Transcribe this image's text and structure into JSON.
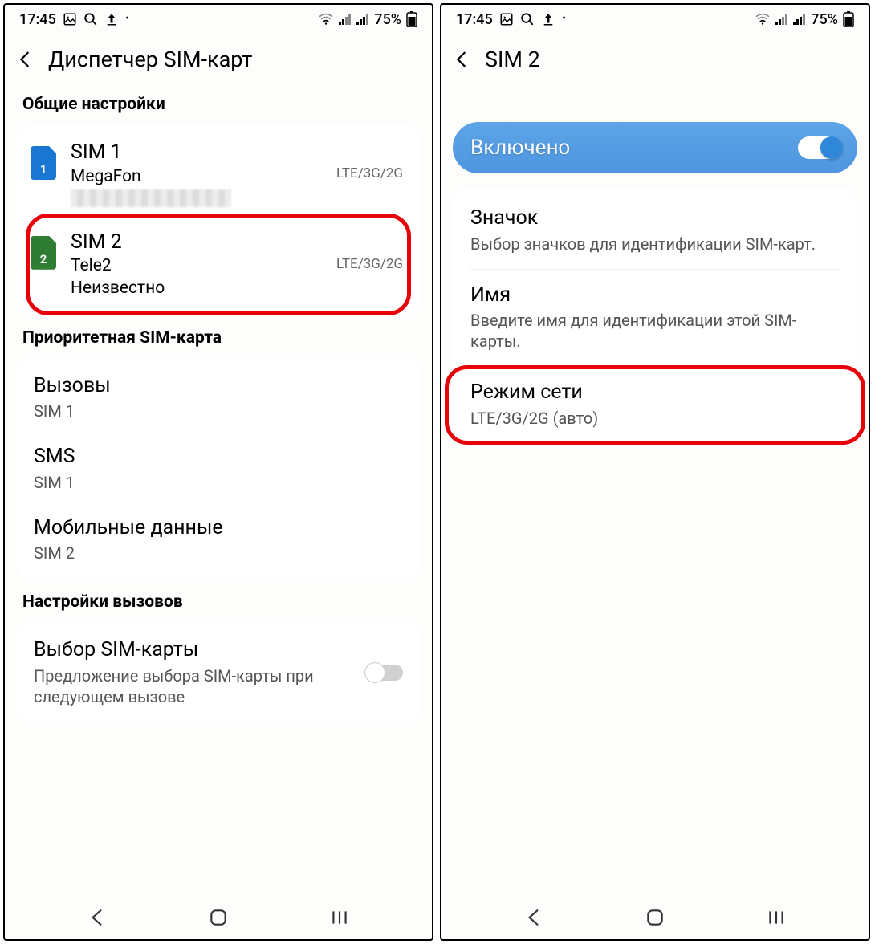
{
  "status": {
    "time": "17:45",
    "battery": "75%"
  },
  "left": {
    "title": "Диспетчер SIM-карт",
    "section_general": "Общие настройки",
    "sim1": {
      "name": "SIM 1",
      "carrier": "MegaFon",
      "mode": "LTE/3G/2G",
      "num": "1"
    },
    "sim2": {
      "name": "SIM 2",
      "carrier": "Tele2",
      "status": "Неизвестно",
      "mode": "LTE/3G/2G",
      "num": "2"
    },
    "section_priority": "Приоритетная SIM-карта",
    "calls": {
      "title": "Вызовы",
      "sub": "SIM 1"
    },
    "sms": {
      "title": "SMS",
      "sub": "SIM 1"
    },
    "data": {
      "title": "Мобильные данные",
      "sub": "SIM 2"
    },
    "section_call_settings": "Настройки вызовов",
    "simselect": {
      "title": "Выбор SIM-карты",
      "sub": "Предложение выбора SIM-карты при следующем вызове"
    }
  },
  "right": {
    "title": "SIM 2",
    "enabled": "Включено",
    "icon": {
      "title": "Значок",
      "sub": "Выбор значков для идентификации SIM-карт."
    },
    "name": {
      "title": "Имя",
      "sub": "Введите имя для идентификации этой SIM-карты."
    },
    "network": {
      "title": "Режим сети",
      "sub": "LTE/3G/2G (авто)"
    }
  }
}
